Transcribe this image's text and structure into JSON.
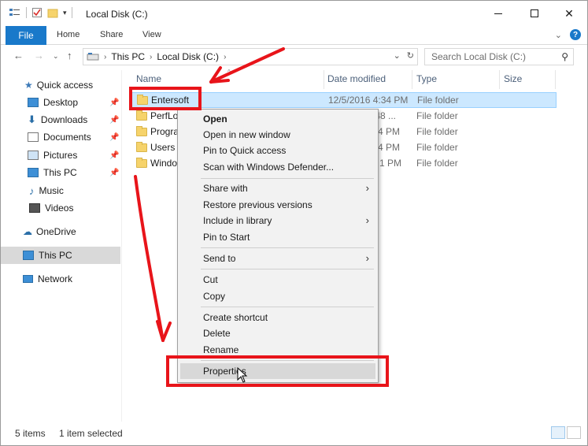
{
  "window": {
    "title": "Local Disk (C:)",
    "controls": {
      "minimize": "minimize",
      "maximize": "maximize",
      "close": "✕"
    }
  },
  "ribbon": {
    "file_tab": "File",
    "tabs": [
      "Home",
      "Share",
      "View"
    ],
    "help": "?"
  },
  "address": {
    "crumbs": [
      "This PC",
      "Local Disk (C:)"
    ],
    "search_placeholder": "Search Local Disk (C:)"
  },
  "sidebar": {
    "items": [
      {
        "label": "Quick access",
        "icon": "star-icon",
        "pinned": false
      },
      {
        "label": "Desktop",
        "icon": "desktop-icon",
        "pinned": true
      },
      {
        "label": "Downloads",
        "icon": "download-icon",
        "pinned": true
      },
      {
        "label": "Documents",
        "icon": "documents-icon",
        "pinned": true
      },
      {
        "label": "Pictures",
        "icon": "pictures-icon",
        "pinned": true
      },
      {
        "label": "This PC",
        "icon": "pc-icon",
        "pinned": true
      },
      {
        "label": "Music",
        "icon": "music-icon",
        "pinned": false
      },
      {
        "label": "Videos",
        "icon": "videos-icon",
        "pinned": false
      },
      {
        "label": "OneDrive",
        "icon": "cloud-icon",
        "pinned": false
      },
      {
        "label": "This PC",
        "icon": "pc-icon",
        "pinned": false,
        "selected": true
      },
      {
        "label": "Network",
        "icon": "network-icon",
        "pinned": false
      }
    ],
    "pin_glyph": "📌"
  },
  "columns": {
    "name": "Name",
    "date": "Date modified",
    "type": "Type",
    "size": "Size"
  },
  "rows": [
    {
      "name": "Entersoft",
      "date": "12/5/2016 4:34 PM",
      "type": "File folder",
      "selected": true
    },
    {
      "name": "PerfLo",
      "date": ":48 ...",
      "type": "File folder"
    },
    {
      "name": "Progra",
      "date": "4 PM",
      "type": "File folder"
    },
    {
      "name": "Users",
      "date": "4 PM",
      "type": "File folder"
    },
    {
      "name": "Windo",
      "date": "1 PM",
      "type": "File folder"
    }
  ],
  "context_menu": {
    "groups": [
      [
        {
          "label": "Open",
          "bold": true
        },
        {
          "label": "Open in new window"
        },
        {
          "label": "Pin to Quick access"
        },
        {
          "label": "Scan with Windows Defender..."
        }
      ],
      [
        {
          "label": "Share with",
          "submenu": true
        },
        {
          "label": "Restore previous versions"
        },
        {
          "label": "Include in library",
          "submenu": true
        },
        {
          "label": "Pin to Start"
        }
      ],
      [
        {
          "label": "Send to",
          "submenu": true
        }
      ],
      [
        {
          "label": "Cut"
        },
        {
          "label": "Copy"
        }
      ],
      [
        {
          "label": "Create shortcut"
        },
        {
          "label": "Delete"
        },
        {
          "label": "Rename"
        }
      ],
      [
        {
          "label": "Properties",
          "hover": true
        }
      ]
    ]
  },
  "status": {
    "count": "5 items",
    "selection": "1 item selected"
  },
  "colors": {
    "accent": "#1979ca",
    "selection": "#cce8ff",
    "annotation": "#e8141a"
  }
}
